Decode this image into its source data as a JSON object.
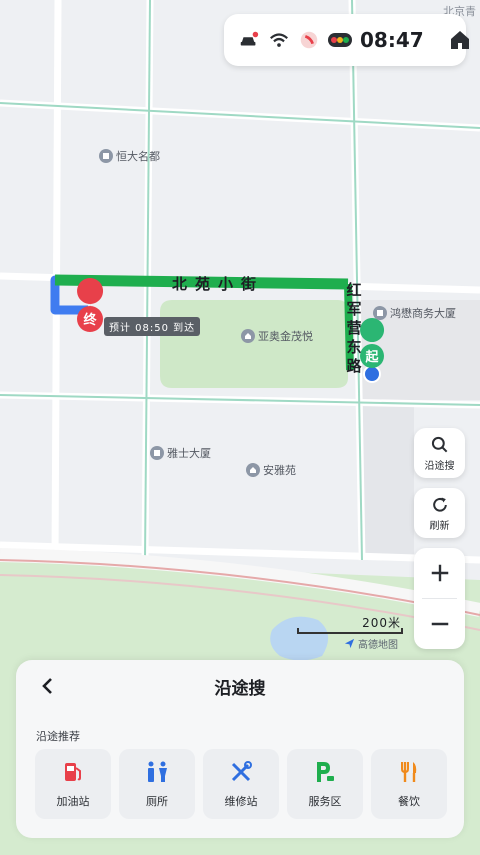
{
  "status_bar": {
    "time": "08:47",
    "icons": [
      "car-icon",
      "wifi-icon",
      "voice-assistant-icon",
      "traffic-light-icon",
      "home-icon"
    ]
  },
  "map": {
    "corner_label": "北京青",
    "streets": {
      "beiyuan": "北苑小街",
      "hongjun": "红军营东路"
    },
    "pois": [
      {
        "name": "恒大名都"
      },
      {
        "name": "鸿懋商务大厦"
      },
      {
        "name": "亚奥金茂悦"
      },
      {
        "name": "雅士大厦"
      },
      {
        "name": "安雅苑"
      }
    ],
    "start_marker": "起",
    "end_marker": "终",
    "eta_label": "预计 08:50 到达",
    "scale_label": "200米",
    "brand": "高德地图",
    "colors": {
      "route": "#1fae4e",
      "route_alt": "#3f7cf0",
      "end_marker": "#e8404a",
      "start_marker": "#2bb673"
    }
  },
  "controls": {
    "search_label": "沿途搜",
    "refresh_label": "刷新",
    "zoom_in": "+",
    "zoom_out": "−"
  },
  "panel": {
    "title": "沿途搜",
    "section_label": "沿途推荐",
    "categories": [
      {
        "label": "加油站",
        "icon": "gas-station-icon",
        "color": "#e8404a"
      },
      {
        "label": "厕所",
        "icon": "toilet-icon",
        "color": "#2f6fe0"
      },
      {
        "label": "维修站",
        "icon": "repair-icon",
        "color": "#2f6fe0"
      },
      {
        "label": "服务区",
        "icon": "service-area-icon",
        "color": "#1fae4e"
      },
      {
        "label": "餐饮",
        "icon": "restaurant-icon",
        "color": "#f08a1c"
      }
    ]
  }
}
